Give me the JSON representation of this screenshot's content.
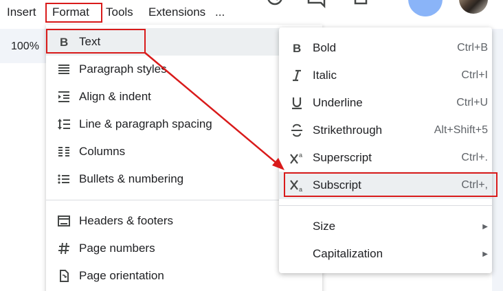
{
  "menubar": {
    "items": [
      "Insert",
      "Format",
      "Tools",
      "Extensions",
      "..."
    ]
  },
  "toolbar": {
    "zoom": "100%"
  },
  "format_menu": {
    "items": [
      {
        "label": "Text",
        "icon": "bold-b-icon"
      },
      {
        "label": "Paragraph styles",
        "icon": "paragraph-styles-icon"
      },
      {
        "label": "Align & indent",
        "icon": "align-indent-icon"
      },
      {
        "label": "Line & paragraph spacing",
        "icon": "line-spacing-icon"
      },
      {
        "label": "Columns",
        "icon": "columns-icon"
      },
      {
        "label": "Bullets & numbering",
        "icon": "bulleted-list-icon"
      },
      {
        "label": "Headers & footers",
        "icon": "headers-footers-icon"
      },
      {
        "label": "Page numbers",
        "icon": "hash-icon"
      },
      {
        "label": "Page orientation",
        "icon": "page-orientation-icon"
      }
    ]
  },
  "text_submenu": {
    "items": [
      {
        "label": "Bold",
        "shortcut": "Ctrl+B",
        "icon": "bold-icon"
      },
      {
        "label": "Italic",
        "shortcut": "Ctrl+I",
        "icon": "italic-icon"
      },
      {
        "label": "Underline",
        "shortcut": "Ctrl+U",
        "icon": "underline-icon"
      },
      {
        "label": "Strikethrough",
        "shortcut": "Alt+Shift+5",
        "icon": "strikethrough-icon"
      },
      {
        "label": "Superscript",
        "shortcut": "Ctrl+.",
        "icon": "superscript-icon"
      },
      {
        "label": "Subscript",
        "shortcut": "Ctrl+,",
        "icon": "subscript-icon"
      },
      {
        "label": "Size",
        "icon": "submenu-arrow-icon"
      },
      {
        "label": "Capitalization",
        "icon": "submenu-arrow-icon"
      }
    ]
  },
  "colors": {
    "highlight": "#d91a1a",
    "menu_hover": "#eceff1",
    "toolbar_bg": "#f1f4f9"
  }
}
